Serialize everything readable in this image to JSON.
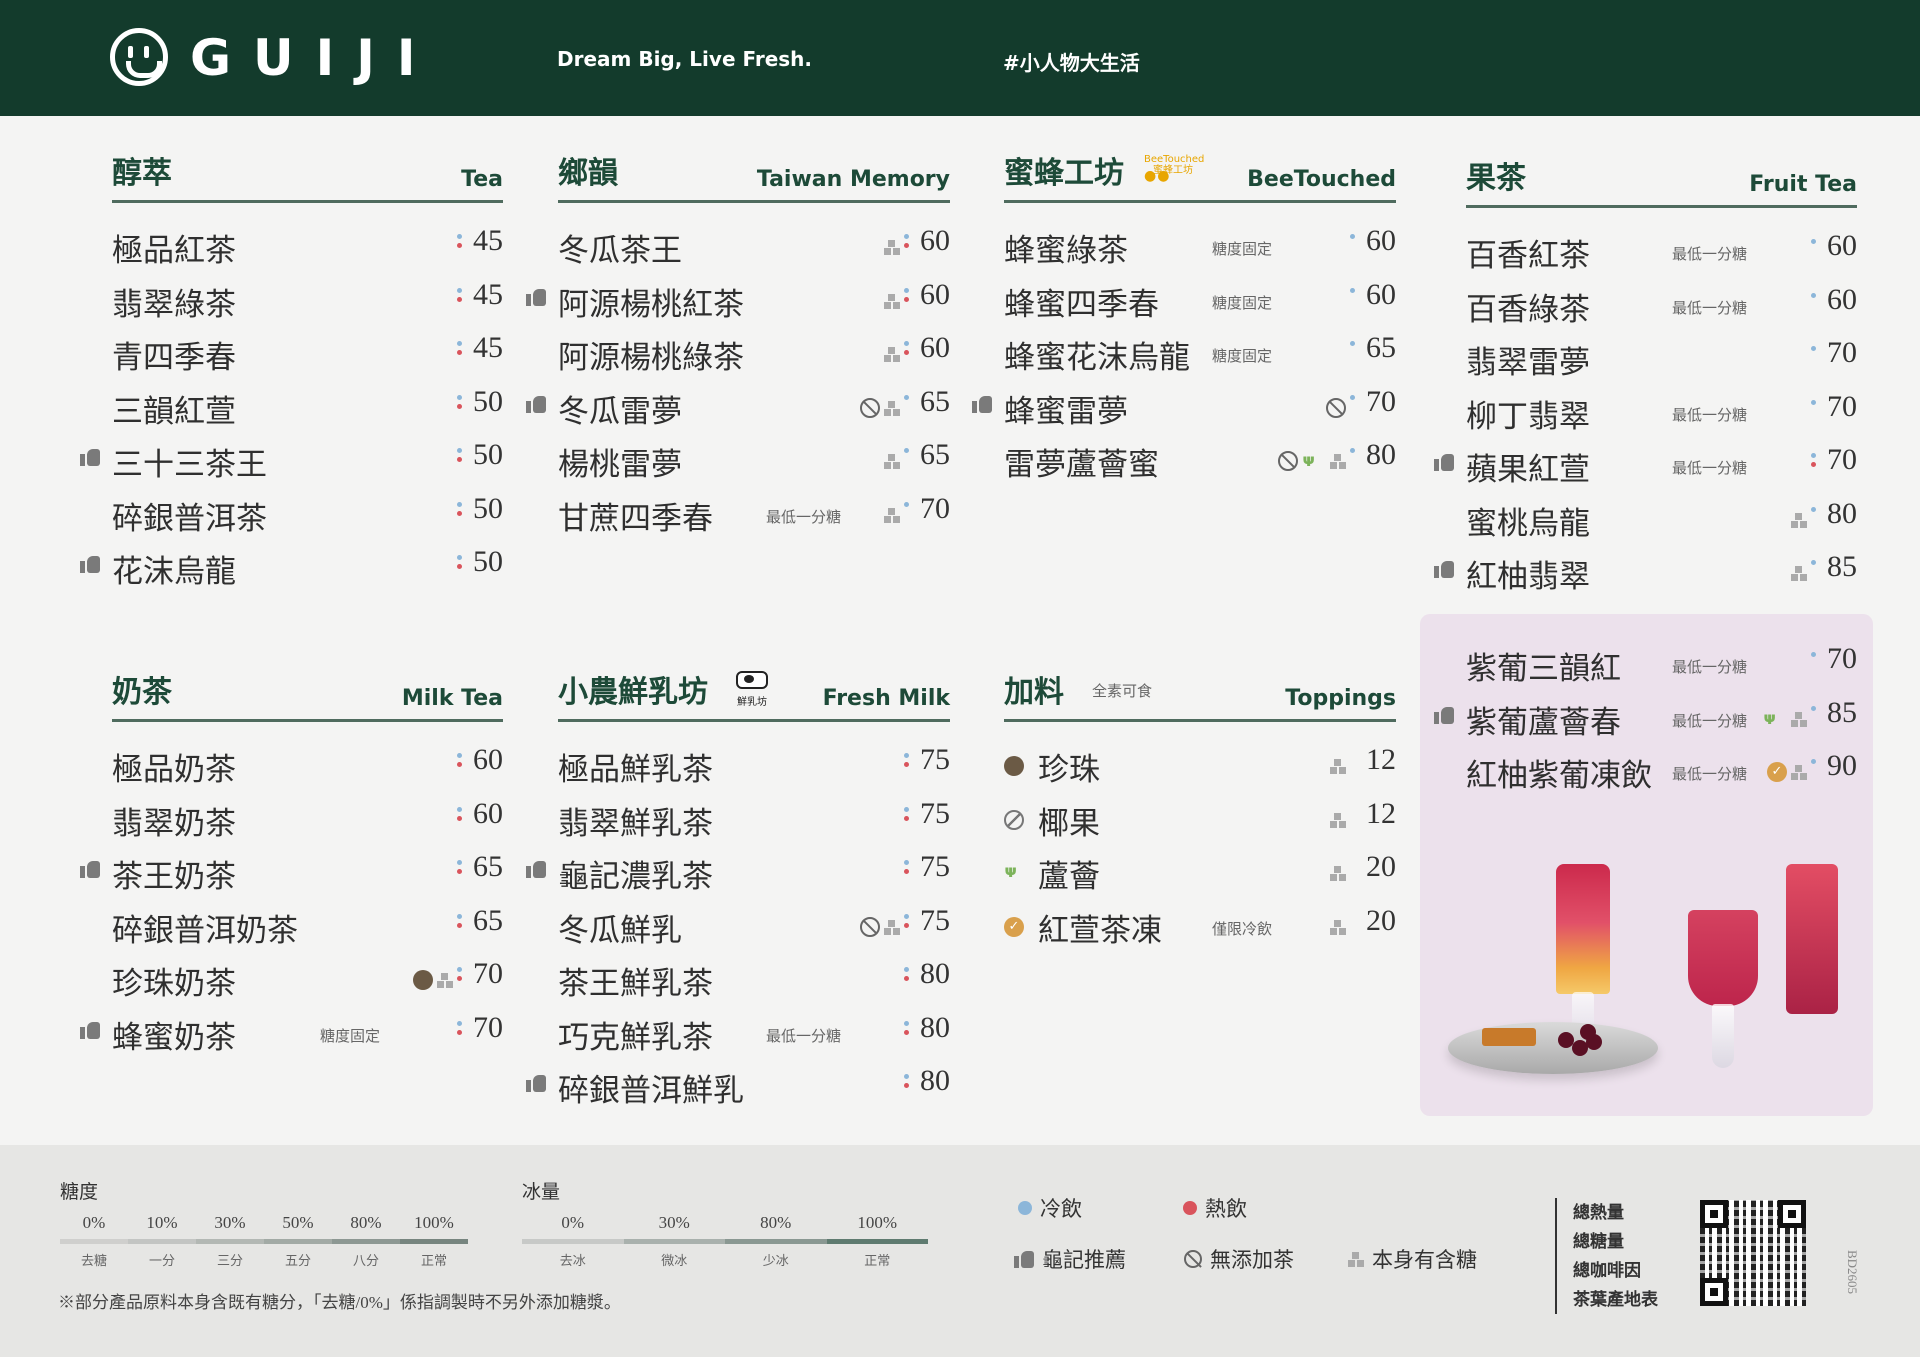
{
  "header": {
    "brand": "GUIJI",
    "tagline": "Dream Big, Live Fresh.",
    "hashtag": "#小人物大生活"
  },
  "sections": {
    "tea": {
      "zh": "醇萃",
      "en": "Tea",
      "items": [
        {
          "name": "極品紅茶",
          "price": "45",
          "rec": false,
          "dots": [
            "cold",
            "hot"
          ]
        },
        {
          "name": "翡翠綠茶",
          "price": "45",
          "rec": false,
          "dots": [
            "cold",
            "hot"
          ]
        },
        {
          "name": "青四季春",
          "price": "45",
          "rec": false,
          "dots": [
            "cold",
            "hot"
          ]
        },
        {
          "name": "三韻紅萱",
          "price": "50",
          "rec": false,
          "dots": [
            "cold",
            "hot"
          ]
        },
        {
          "name": "三十三茶王",
          "price": "50",
          "rec": true,
          "dots": [
            "cold",
            "hot"
          ]
        },
        {
          "name": "碎銀普洱茶",
          "price": "50",
          "rec": false,
          "dots": [
            "cold",
            "hot"
          ]
        },
        {
          "name": "花沫烏龍",
          "price": "50",
          "rec": true,
          "dots": [
            "cold",
            "hot"
          ]
        }
      ]
    },
    "memory": {
      "zh": "鄉韻",
      "en": "Taiwan Memory",
      "items": [
        {
          "name": "冬瓜茶王",
          "price": "60",
          "rec": false,
          "dots": [
            "cold",
            "hot"
          ],
          "icons": [
            "sugar"
          ]
        },
        {
          "name": "阿源楊桃紅茶",
          "price": "60",
          "rec": true,
          "dots": [
            "cold",
            "hot"
          ],
          "icons": [
            "sugar"
          ]
        },
        {
          "name": "阿源楊桃綠茶",
          "price": "60",
          "rec": false,
          "dots": [
            "cold",
            "hot"
          ],
          "icons": [
            "sugar"
          ]
        },
        {
          "name": "冬瓜雷夢",
          "price": "65",
          "rec": true,
          "dots": [
            "cold"
          ],
          "icons": [
            "noadd",
            "sugar"
          ]
        },
        {
          "name": "楊桃雷夢",
          "price": "65",
          "rec": false,
          "dots": [
            "cold"
          ],
          "icons": [
            "sugar"
          ]
        },
        {
          "name": "甘蔗四季春",
          "price": "70",
          "rec": false,
          "dots": [
            "cold"
          ],
          "icons": [
            "sugar"
          ],
          "note": "最低一分糖"
        }
      ]
    },
    "bee": {
      "zh": "蜜蜂工坊",
      "en": "BeeTouched",
      "badge_en": "BeeTouched",
      "badge_zh": "蜜蜂工坊",
      "items": [
        {
          "name": "蜂蜜綠茶",
          "price": "60",
          "rec": false,
          "dots": [
            "cold"
          ],
          "note": "糖度固定"
        },
        {
          "name": "蜂蜜四季春",
          "price": "60",
          "rec": false,
          "dots": [
            "cold"
          ],
          "note": "糖度固定"
        },
        {
          "name": "蜂蜜花沫烏龍",
          "price": "65",
          "rec": false,
          "dots": [
            "cold"
          ],
          "note": "糖度固定"
        },
        {
          "name": "蜂蜜雷夢",
          "price": "70",
          "rec": true,
          "dots": [
            "cold"
          ],
          "icons": [
            "noadd"
          ]
        },
        {
          "name": "雷夢蘆薈蜜",
          "price": "80",
          "rec": false,
          "dots": [
            "cold"
          ],
          "icons": [
            "noadd",
            "aloe",
            "sugar"
          ]
        }
      ]
    },
    "fruit": {
      "zh": "果茶",
      "en": "Fruit Tea",
      "items": [
        {
          "name": "百香紅茶",
          "price": "60",
          "rec": false,
          "dots": [
            "cold"
          ],
          "note": "最低一分糖"
        },
        {
          "name": "百香綠茶",
          "price": "60",
          "rec": false,
          "dots": [
            "cold"
          ],
          "note": "最低一分糖"
        },
        {
          "name": "翡翠雷夢",
          "price": "70",
          "rec": false,
          "dots": [
            "cold"
          ]
        },
        {
          "name": "柳丁翡翠",
          "price": "70",
          "rec": false,
          "dots": [
            "cold"
          ],
          "note": "最低一分糖"
        },
        {
          "name": "蘋果紅萱",
          "price": "70",
          "rec": true,
          "dots": [
            "cold",
            "hot"
          ],
          "note": "最低一分糖"
        },
        {
          "name": "蜜桃烏龍",
          "price": "80",
          "rec": false,
          "dots": [
            "cold"
          ],
          "icons": [
            "sugar"
          ]
        },
        {
          "name": "紅柚翡翠",
          "price": "85",
          "rec": true,
          "dots": [
            "cold"
          ],
          "icons": [
            "sugar"
          ]
        }
      ]
    },
    "promo": {
      "items": [
        {
          "name": "紫葡三韻紅",
          "price": "70",
          "rec": false,
          "dots": [
            "cold"
          ],
          "note": "最低一分糖"
        },
        {
          "name": "紫葡蘆薈春",
          "price": "85",
          "rec": true,
          "dots": [
            "cold"
          ],
          "note": "最低一分糖",
          "icons": [
            "aloe",
            "sugar"
          ]
        },
        {
          "name": "紅柚紫葡凍飲",
          "price": "90",
          "rec": false,
          "dots": [
            "cold"
          ],
          "note": "最低一分糖",
          "icons": [
            "jelly",
            "sugar"
          ]
        }
      ]
    },
    "milktea": {
      "zh": "奶茶",
      "en": "Milk Tea",
      "items": [
        {
          "name": "極品奶茶",
          "price": "60",
          "rec": false,
          "dots": [
            "cold",
            "hot"
          ]
        },
        {
          "name": "翡翠奶茶",
          "price": "60",
          "rec": false,
          "dots": [
            "cold",
            "hot"
          ]
        },
        {
          "name": "茶王奶茶",
          "price": "65",
          "rec": true,
          "dots": [
            "cold",
            "hot"
          ]
        },
        {
          "name": "碎銀普洱奶茶",
          "price": "65",
          "rec": false,
          "dots": [
            "cold",
            "hot"
          ]
        },
        {
          "name": "珍珠奶茶",
          "price": "70",
          "rec": false,
          "dots": [
            "cold",
            "hot"
          ],
          "icons": [
            "pearl",
            "sugar"
          ]
        },
        {
          "name": "蜂蜜奶茶",
          "price": "70",
          "rec": true,
          "dots": [
            "cold",
            "hot"
          ],
          "note": "糖度固定"
        }
      ]
    },
    "freshmilk": {
      "zh": "小農鮮乳坊",
      "en": "Fresh Milk",
      "badge": "鮮乳坊",
      "items": [
        {
          "name": "極品鮮乳茶",
          "price": "75",
          "rec": false,
          "dots": [
            "cold",
            "hot"
          ]
        },
        {
          "name": "翡翠鮮乳茶",
          "price": "75",
          "rec": false,
          "dots": [
            "cold",
            "hot"
          ]
        },
        {
          "name": "龜記濃乳茶",
          "price": "75",
          "rec": true,
          "dots": [
            "cold",
            "hot"
          ]
        },
        {
          "name": "冬瓜鮮乳",
          "price": "75",
          "rec": false,
          "dots": [
            "cold",
            "hot"
          ],
          "icons": [
            "noadd",
            "sugar"
          ]
        },
        {
          "name": "茶王鮮乳茶",
          "price": "80",
          "rec": false,
          "dots": [
            "cold",
            "hot"
          ]
        },
        {
          "name": "巧克鮮乳茶",
          "price": "80",
          "rec": false,
          "dots": [
            "cold",
            "hot"
          ],
          "note": "最低一分糖"
        },
        {
          "name": "碎銀普洱鮮乳",
          "price": "80",
          "rec": true,
          "dots": [
            "cold",
            "hot"
          ]
        }
      ]
    },
    "toppings": {
      "zh": "加料",
      "en": "Toppings",
      "note": "全素可食",
      "items": [
        {
          "name": "珍珠",
          "price": "12",
          "icon": "pearl",
          "icons": [
            "sugar"
          ]
        },
        {
          "name": "椰果",
          "price": "12",
          "icon": "coconut",
          "icons": [
            "sugar"
          ]
        },
        {
          "name": "蘆薈",
          "price": "20",
          "icon": "aloe",
          "icons": [
            "sugar"
          ]
        },
        {
          "name": "紅萱茶凍",
          "price": "20",
          "icon": "jelly",
          "icons": [
            "sugar"
          ],
          "note": "僅限冷飲"
        }
      ]
    }
  },
  "legend": {
    "sugar_title": "糖度",
    "sugar": [
      {
        "pct": "0%",
        "label": "去糖"
      },
      {
        "pct": "10%",
        "label": "一分"
      },
      {
        "pct": "30%",
        "label": "三分"
      },
      {
        "pct": "50%",
        "label": "五分"
      },
      {
        "pct": "80%",
        "label": "八分"
      },
      {
        "pct": "100%",
        "label": "正常"
      }
    ],
    "ice_title": "冰量",
    "ice": [
      {
        "pct": "0%",
        "label": "去冰"
      },
      {
        "pct": "30%",
        "label": "微冰"
      },
      {
        "pct": "80%",
        "label": "少冰"
      },
      {
        "pct": "100%",
        "label": "正常"
      }
    ],
    "footnote": "※部分產品原料本身含既有糖分，「去糖/0%」係指調製時不另外添加糖漿。",
    "cold": "冷飲",
    "hot": "熱飲",
    "recommend": "龜記推薦",
    "no_add": "無添加茶",
    "has_sugar": "本身有含糖",
    "info": [
      "總熱量",
      "總糖量",
      "總咖啡因",
      "茶葉產地表"
    ],
    "code": "BD2605",
    "colors": {
      "cold": "#8cb6d9",
      "hot": "#d9545c",
      "brand": "#133b2c"
    }
  }
}
